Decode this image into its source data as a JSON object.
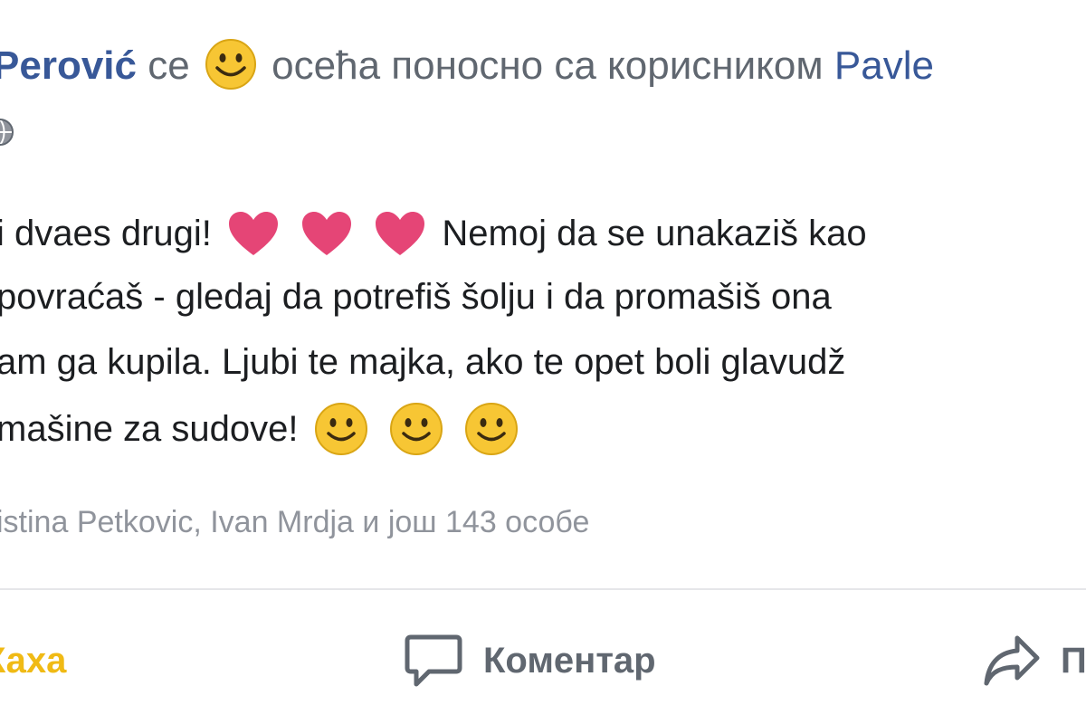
{
  "post": {
    "author": "Perović",
    "feeling_prefix": "се",
    "feeling_text": "осећа поносно са корисником",
    "tagged_user": "Pavle",
    "lines": [
      {
        "parts": [
          "i dvaes drugi!",
          "heart",
          "heart",
          "heart",
          "Nemoj da se unakaziš kao"
        ]
      },
      {
        "parts": [
          "povraćaš - gledaj da potrefiš šolju i da promašiš ona"
        ]
      },
      {
        "parts": [
          "am ga kupila. Ljubi te majka, ako te opet boli glavudž"
        ]
      },
      {
        "parts": [
          "mašine za sudove!",
          "smile",
          "smile",
          "smile"
        ]
      }
    ],
    "line1_text": "i dvaes drugi!",
    "line1_tail": "Nemoj da se unakaziš kao",
    "line2": "povraćaš - gledaj da potrefiš šolju i da promašiš ona",
    "line3": "am ga kupila. Ljubi te majka, ako te opet boli glavudž",
    "line4": "mašine za sudove!"
  },
  "reactions": {
    "summary": "istina Petkovic, Ivan Mrdja и још 143 особе"
  },
  "actions": {
    "haha_label": "Хаха",
    "comment_label": "Коментар",
    "share_label": "П"
  },
  "colors": {
    "link": "#385898",
    "secondary_text": "#606770",
    "muted_text": "#90949c",
    "heart": "#e0245e",
    "haha": "#f0ba15",
    "emoji_yellow": "#f7c634"
  },
  "icons": {
    "feeling": "smile-emoji-icon",
    "privacy": "globe-icon",
    "comment": "comment-bubble-icon",
    "share": "share-arrow-icon",
    "heart": "heart-emoji-icon",
    "smile": "smile-emoji-icon"
  }
}
